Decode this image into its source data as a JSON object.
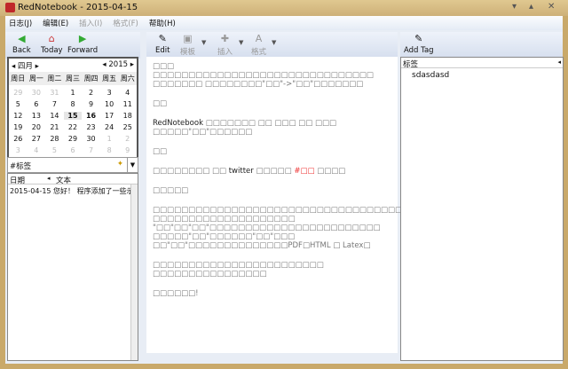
{
  "window": {
    "title": "RedNotebook - 2015-04-15"
  },
  "menu": [
    "日志(J)",
    "编辑(E)",
    "插入(I)",
    "格式(F)",
    "帮助(H)"
  ],
  "nav": {
    "back": "Back",
    "today": "Today",
    "forward": "Forward"
  },
  "toolbar": {
    "edit": "Edit",
    "template": "模板",
    "insert": "插入",
    "format": "格式",
    "add_tag": "Add Tag"
  },
  "calendar": {
    "month": "四月",
    "year": "2015",
    "weekdays": [
      "周日",
      "周一",
      "周二",
      "周三",
      "周四",
      "周五",
      "周六"
    ],
    "days": [
      "29",
      "30",
      "31",
      "1",
      "2",
      "3",
      "4",
      "5",
      "6",
      "7",
      "8",
      "9",
      "10",
      "11",
      "12",
      "13",
      "14",
      "15",
      "16",
      "17",
      "18",
      "19",
      "20",
      "21",
      "22",
      "23",
      "24",
      "25",
      "26",
      "27",
      "28",
      "29",
      "30",
      "1",
      "2",
      "3",
      "4",
      "5",
      "6",
      "7",
      "8",
      "9"
    ]
  },
  "search": {
    "value": "#标签"
  },
  "list": {
    "col_date": "日期",
    "col_text": "文本",
    "rows": [
      {
        "date": "2015-04-15",
        "text": "您好！ 程序添加了一些示例文:"
      }
    ]
  },
  "editor": {
    "paragraphs": [
      "□□□ □□□□□□□□□□□□□□□□□□□□□□□□□□□□□□□ □□□□□□□ □□□□□□□□\"□□\"->\"□□\"□□□□□□□",
      "□□",
      [
        "RedNotebook",
        " □□□□□□□ □□ □□□ □□ □□□ □□□□□\"□□\"□□□□□□"
      ],
      "□□",
      [
        "□□□□□□□□ □□ ",
        "twitter",
        " □□□□□ ",
        "#□□",
        " □□□□"
      ],
      "□□□□□",
      "□□□□□□□□□□□□□□□□□□□□□□□□□□□□□□□□□□□□□□□□□□□ □□□□□□□□□□□□□□□□□□□□ \"□□\"□□\"□□\"□□□□□□□□□□□□□□□□□□□□□□□□ □□□□□\"□□\"□□□□□□\"□□\"□□□ □□\"□□\"□□□□□□□□□□□□□□PDF□HTML □ Latex□",
      "□□□□□□□□□□□□□□□□□□□□□□□□ □□□□□□□□□□□□□□□□",
      "□□□□□□!"
    ]
  },
  "tags": {
    "header": "标签",
    "items": [
      "sdasdasd"
    ]
  }
}
